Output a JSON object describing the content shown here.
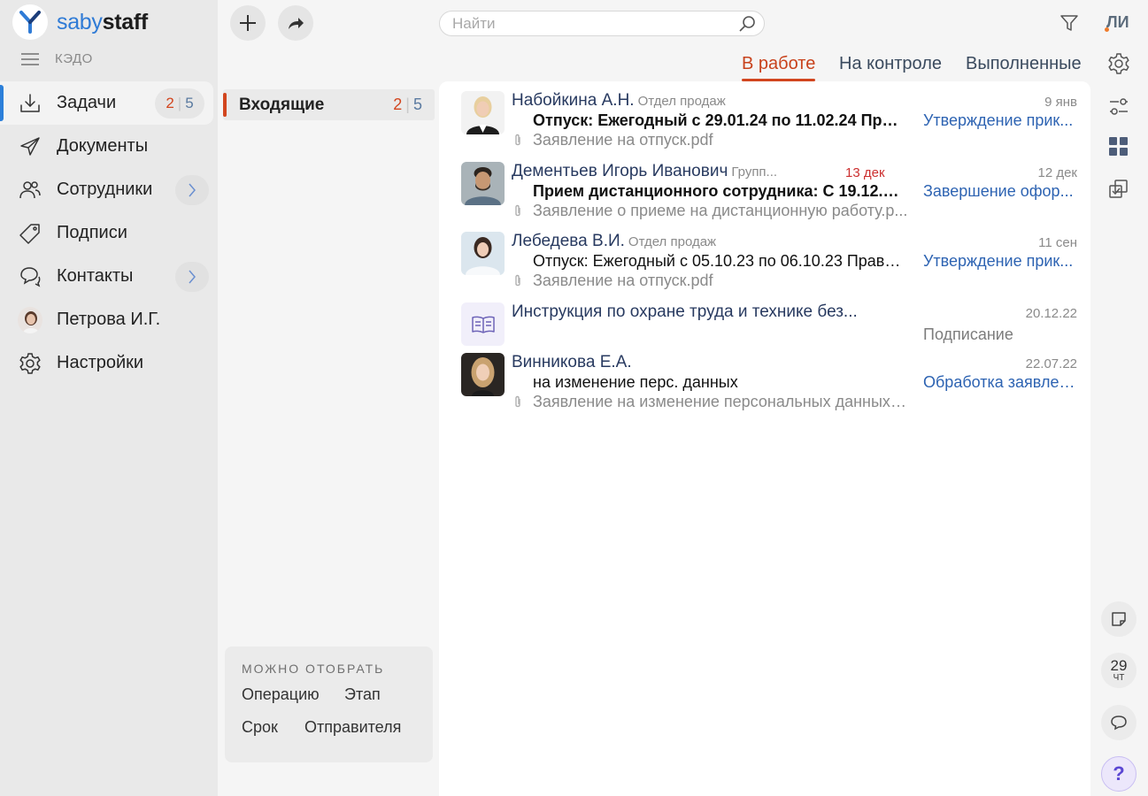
{
  "app": {
    "logo_part1": "saby",
    "logo_part2": "staff",
    "section_label": "КЭДО"
  },
  "nav": {
    "items": [
      {
        "label": "Задачи",
        "icon": "inbox-download-icon",
        "badge_new": "2",
        "badge_total": "5"
      },
      {
        "label": "Документы",
        "icon": "paper-plane-icon"
      },
      {
        "label": "Сотрудники",
        "icon": "people-icon"
      },
      {
        "label": "Подписи",
        "icon": "signature-tag-icon"
      },
      {
        "label": "Контакты",
        "icon": "chat-bubbles-icon"
      },
      {
        "label": "Петрова И.Г.",
        "icon": "user-avatar"
      },
      {
        "label": "Настройки",
        "icon": "gear-icon"
      }
    ]
  },
  "toolbar": {
    "search_placeholder": "Найти"
  },
  "user": {
    "initials": "ЛИ"
  },
  "tabs": [
    {
      "label": "В работе",
      "active": true
    },
    {
      "label": "На контроле",
      "active": false
    },
    {
      "label": "Выполненные",
      "active": false
    }
  ],
  "folders": [
    {
      "name": "Входящие",
      "count_new": "2",
      "count_total": "5"
    }
  ],
  "filter_panel": {
    "title": "МОЖНО ОТОБРАТЬ",
    "options": [
      "Операцию",
      "Этап",
      "Срок",
      "Отправителя"
    ]
  },
  "tasks": [
    {
      "name": "Набойкина А.Н.",
      "dept": "Отдел продаж",
      "date": "9 янв",
      "subject": "Отпуск: Ежегодный с 29.01.24 по 11.02.24 Прав...",
      "subject_bold": true,
      "stage": "Утверждение прик...",
      "attachment": "Заявление на отпуск.pdf"
    },
    {
      "name": "Дементьев Игорь Иванович",
      "dept": "Групп...",
      "due": "13 дек",
      "date": "12 дек",
      "subject": "Прием дистанционного сотрудника: С 19.12.23 ...",
      "subject_bold": true,
      "stage": "Завершение офор...",
      "attachment": "Заявление о приеме на дистанционную работу.р..."
    },
    {
      "name": "Лебедева В.И.",
      "dept": "Отдел продаж",
      "date": "11 сен",
      "subject": "Отпуск: Ежегодный с 05.10.23 по 06.10.23 Прави...",
      "subject_bold": false,
      "stage": "Утверждение прик...",
      "attachment": "Заявление на отпуск.pdf"
    },
    {
      "title": "Инструкция по охране труда и технике без...",
      "date": "20.12.22",
      "stage": "Подписание",
      "icon": "book-icon"
    },
    {
      "name": "Винникова Е.А.",
      "date": "22.07.22",
      "subject": "на изменение перс. данных",
      "subject_bold": false,
      "stage": "Обработка заявлен...",
      "attachment": "Заявление на изменение персональных данных.р..."
    }
  ],
  "rail": {
    "date_day": "29",
    "date_weekday": "ЧТ",
    "help": "?"
  },
  "colors": {
    "accent_red": "#d2461f",
    "link_blue": "#2d63b2",
    "brand_blue": "#2f7bd6"
  }
}
